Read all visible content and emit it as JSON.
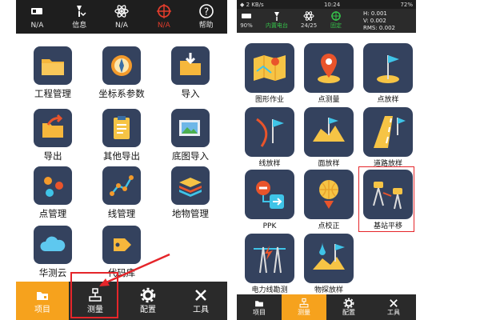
{
  "left": {
    "topbar": [
      {
        "label": "N/A",
        "icon": "receiver-icon"
      },
      {
        "label": "信息",
        "icon": "info-antenna-icon"
      },
      {
        "label": "N/A",
        "icon": "satellite-icon"
      },
      {
        "label": "N/A",
        "icon": "crosshair-icon",
        "color": "#e03c2c"
      },
      {
        "label": "帮助",
        "icon": "help-icon"
      }
    ],
    "items": [
      {
        "label": "工程管理",
        "icon": "folder-icon"
      },
      {
        "label": "坐标系参数",
        "icon": "compass-icon"
      },
      {
        "label": "导入",
        "icon": "import-icon"
      },
      {
        "label": "导出",
        "icon": "export-icon"
      },
      {
        "label": "其他导出",
        "icon": "clipboard-icon"
      },
      {
        "label": "底图导入",
        "icon": "image-icon"
      },
      {
        "label": "点管理",
        "icon": "points-icon"
      },
      {
        "label": "线管理",
        "icon": "line-icon"
      },
      {
        "label": "地物管理",
        "icon": "layers-icon"
      },
      {
        "label": "华测云",
        "icon": "cloud-icon"
      },
      {
        "label": "代码库",
        "icon": "tag-icon"
      }
    ],
    "tabs": [
      {
        "label": "项目",
        "icon": "project-icon",
        "active": true
      },
      {
        "label": "测量",
        "icon": "survey-icon",
        "active": false
      },
      {
        "label": "配置",
        "icon": "config-icon",
        "active": false
      },
      {
        "label": "工具",
        "icon": "tools-icon",
        "active": false
      }
    ]
  },
  "right": {
    "status": {
      "left": "◆ 2 KB/s",
      "time": "10:24",
      "battery": "72%"
    },
    "info": [
      {
        "label": "90%",
        "icon": "receiver-icon"
      },
      {
        "label": "内置电台",
        "icon": "radio-icon",
        "color": "#35c24a"
      },
      {
        "label": "24/25",
        "icon": "satellite-icon"
      },
      {
        "label": "固定",
        "icon": "fixed-icon",
        "color": "#35c24a"
      }
    ],
    "hv": {
      "h": "H: 0.001",
      "v": "V: 0.002",
      "rms": "RMS: 0.002"
    },
    "items": [
      {
        "label": "图形作业",
        "icon": "map-work-icon"
      },
      {
        "label": "点测量",
        "icon": "point-survey-icon"
      },
      {
        "label": "点放样",
        "icon": "point-stakeout-icon"
      },
      {
        "label": "线放样",
        "icon": "line-stakeout-icon"
      },
      {
        "label": "面放样",
        "icon": "surface-stakeout-icon"
      },
      {
        "label": "道路放样",
        "icon": "road-stakeout-icon"
      },
      {
        "label": "PPK",
        "icon": "ppk-icon"
      },
      {
        "label": "点校正",
        "icon": "point-calibration-icon"
      },
      {
        "label": "基站平移",
        "icon": "base-shift-icon"
      },
      {
        "label": "电力线勘测",
        "icon": "powerline-icon"
      },
      {
        "label": "物探放样",
        "icon": "geophysical-icon"
      }
    ],
    "tabs": [
      {
        "label": "项目",
        "icon": "project-icon",
        "active": false
      },
      {
        "label": "测量",
        "icon": "survey-icon",
        "active": true
      },
      {
        "label": "配置",
        "icon": "config-icon",
        "active": false
      },
      {
        "label": "工具",
        "icon": "tools-icon",
        "active": false
      }
    ]
  },
  "accent": "#f6a21d",
  "highlight": "#e5252a"
}
